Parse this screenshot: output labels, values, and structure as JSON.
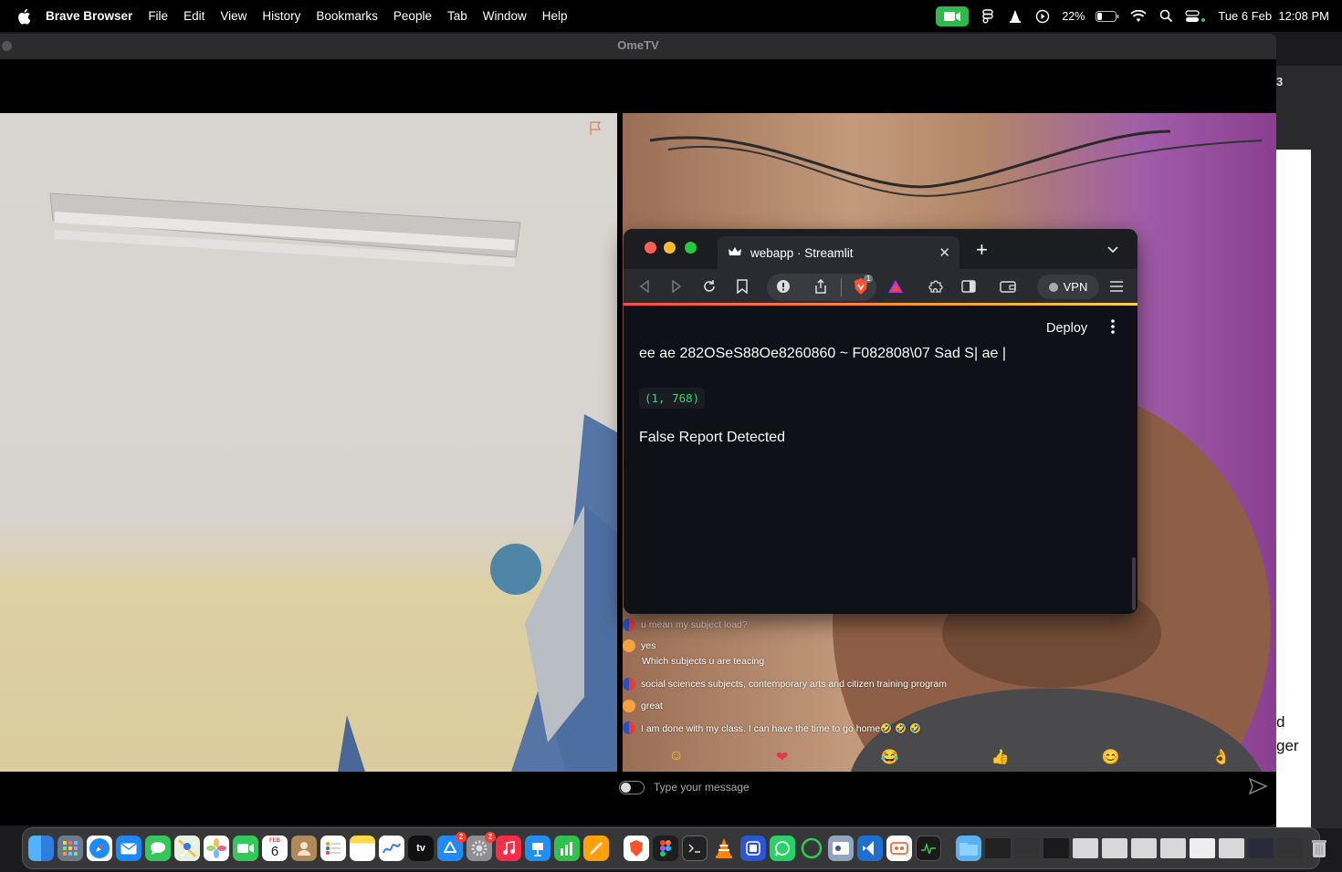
{
  "menubar": {
    "app": "Brave Browser",
    "items": [
      "File",
      "Edit",
      "View",
      "History",
      "Bookmarks",
      "People",
      "Tab",
      "Window",
      "Help"
    ],
    "battery": "22%",
    "datetime": "Tue 6 Feb  12:08 PM"
  },
  "background_window": {
    "tab_number": "3",
    "text_fragment_1": "d",
    "text_fragment_2": "ger"
  },
  "ometv": {
    "title": "OmeTV",
    "chat": [
      {
        "avatar": "ph",
        "text": "u mean my subject load?"
      },
      {
        "avatar": "me",
        "text": "yes"
      },
      {
        "avatar": "none",
        "text": "Which subjects u are teacing"
      },
      {
        "avatar": "ph",
        "text": "social sciences subjects, contemporary arts and citizen training program"
      },
      {
        "avatar": "me",
        "text": "great"
      },
      {
        "avatar": "ph",
        "text": "I am done with my class. I can have the time to go home🤣 🤣 🤣"
      }
    ],
    "emojis": [
      "☺",
      "❤",
      "😂",
      "👍",
      "😊",
      "👌"
    ],
    "message_placeholder": "Type your message"
  },
  "streamlit_window": {
    "tab_title": "webapp · Streamlit",
    "vpn_label": "VPN",
    "shield_badge": "1",
    "deploy_label": "Deploy",
    "ocr_text": "ee ae 282OSeS88Oe8260860 ~ F082808\\07 Sad S| ae |",
    "shape_output": "(1, 768)",
    "result_text": "False Report Detected"
  },
  "dock": {
    "calendar_day": "6",
    "calendar_month": "FEB",
    "appstore_badge": "2",
    "settings_badge": "2",
    "tv_label": "tv"
  }
}
